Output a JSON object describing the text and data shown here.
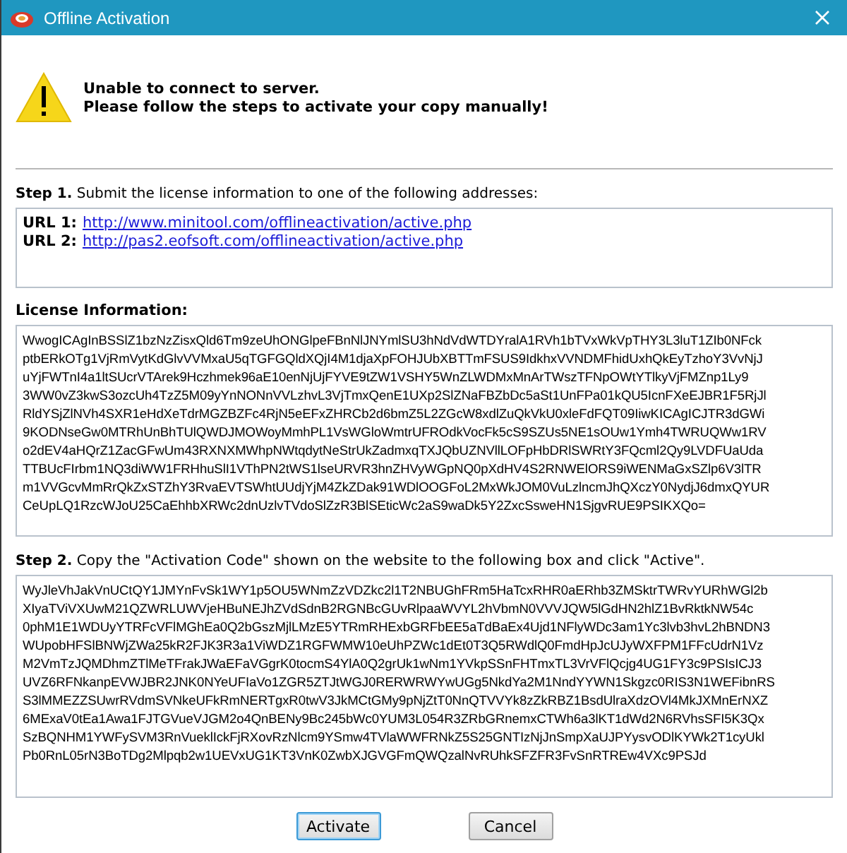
{
  "window": {
    "title": "Offline Activation"
  },
  "header": {
    "lines": [
      "Unable to connect to server.",
      "Please follow the steps to activate your copy manually!"
    ]
  },
  "step1": {
    "text": "**Step 1.** Submit the license information to one of the following addresses:",
    "urls": [
      {
        "label": "URL 1:",
        "link": "http://www.minitool.com/offlineactivation/active.php"
      },
      {
        "label": "URL 2:",
        "link": "http://pas2.eofsoft.com/offlineactivation/active.php"
      }
    ]
  },
  "license": {
    "label": "License Information:",
    "lines": [
      "WwogICAgInBSSlZ1bzNzZisxQld6Tm9zeUhONGlpeFBnNlJNYmlSU3hNdVdWTDYralA1RVh1bTVxWkVpTHY3L3luT1ZIb0NFck",
      "ptbERkOTg1VjRmVytKdGlvVVMxaU5qTGFGQldXQjI4M1djaXpFOHJUbXBTTmFSUS9IdkhxVVNDMFhidUxhQkEyTzhoY3VvNjJ",
      "uYjFWTnI4a1ltSUcrVTArek9Hczhmek96aE10enNjUjFYVE9tZW1VSHY5WnZLWDMxMnArTWszTFNpOWtYTlkyVjFMZnp1Ly9",
      "3WW0vZ3kwS3ozcUh4TzZ5M09yYnNONnVVLzhvL3VjTmxQenE1UXp2SlZNaFBZbDc5aSt1UnFPa01kQU5IcnFXeEJBR1F5RjJl",
      "RldYSjZlNVh4SXR1eHdXeTdrMGZBZFc4RjN5eEFxZHRCb2d6bmZ5L2ZGcW8xdlZuQkVkU0xleFdFQT09IiwKICAgICJTR3dGWi",
      "9KODNseGw0MTRhUnBhTUlQWDJMOWoyMmhPL1VsWGloWmtrUFROdkVocFk5cS9SZUs5NE1sOUw1Ymh4TWRUQWw1RV",
      "o2dEV4aHQrZ1ZacGFwUm43RXNXMWhpNWtqdytNeStrUkZadmxqTXJQbUZNVllLOFpHbDRlSWRtY3FQcml2Qy9LVDFUaUda",
      "TTBUcFIrbm1NQ3diWW1FRHhuSlI1VThPN2tWS1lseURVR3hnZHVyWGpNQ0pXdHV4S2RNWElORS9iWENMaGxSZlp6V3lTR",
      "m1VVGcvMmRrQkZxSTZhY3RvaEVTSWhtUUdjYjM4ZkZDak91WDlOOGFoL2MxWkJOM0VuLzlncmJhQXczY0NydjJ6dmxQYUR",
      "CeUpLQ1RzcWJoU25CaEhhbXRWc2dnUzlvTVdoSlZzR3BlSEticWc2aS9waDk5Y2ZxcSsweHN1SjgvRUE9PSIKXQo="
    ]
  },
  "step2": {
    "text": "**Step 2.** Copy the \"Activation Code\" shown on the website to the following box and click \"Active\"."
  },
  "activation_code": {
    "lines": [
      "WyJleVhJakVnUCtQY1JMYnFvSk1WY1p5OU5WNmZzVDZkc2l1T2NBUGhFRm5HaTcxRHR0aERhb3ZMSktrTWRvYURhWGl2b",
      "XIyaTViVXUwM21QZWRLUWVjeHBuNEJhZVdSdnB2RGNBcGUvRlpaaWVYL2hVbmN0VVVJQW5lGdHN2hlZ1BvRktkNW54c",
      "0phM1E1WDUyYTRFcVFlMGhEa0Q2bGszMjlLMzE5YTRmRHExbGRFbEE5aTdBaEx4Ujd1NFlyWDc3am1Yc3lvb3hvL2hBNDN3",
      "WUpobHFSlBNWjZWa25kR2FJK3R3a1ViWDZ1RGFWMW10eUhPZWc1dEt0T3Q5RWdlQ0FmdHpJcUJyWXFPM1FFcUdrN1Vz",
      "M2VmTzJQMDhmZTlMeTFrakJWaEFaVGgrK0tocmS4YlA0Q2grUk1wNm1YVkpSSnFHTmxTL3VrVFlQcjg4UG1FY3c9PSIsICJ3",
      "UVZ6RFNkanpEVWJBR2JNK0NYeUFIaVo1ZGR5ZTJtWGJ0RERWRWYwUGg5NkdYa2M1NndYYWN1Skgzc0RIS3N1WEFibnRS",
      "S3lMMEZZSUwrRVdmSVNkeUFkRmNERTgxR0twV3JkMCtGMy9pNjZtT0NnQTVVYk8zZkRBZ1BsdUlraXdzOVl4MkJXMnErNXZ",
      "6MExaV0tEa1Awa1FJTGVueVJGM2o4QnBENy9Bc245bWc0YUM3L054R3ZRbGRnemxCTWh6a3lKT1dWd2N6RVhsSFI5K3Qx",
      "SzBQNHM1YWFySVM3RnVueklIckFjRXovRzNlcm9YSmw4TVlaWWFRNkZ5S25GNTIzNjJnSmpXaUJPYysvODlKYWk2T1cyUkl",
      "Pb0RnL05rN3BoTDg2Mlpqb2w1UEVxUG1KT3VnK0ZwbXJGVGFmQWQzalNvRUhkSFZFR3FvSnRTREw4VXc9PSJd"
    ]
  },
  "buttons": [
    {
      "label": "Activate",
      "focused": true
    },
    {
      "label": "Cancel",
      "focused": false
    }
  ]
}
